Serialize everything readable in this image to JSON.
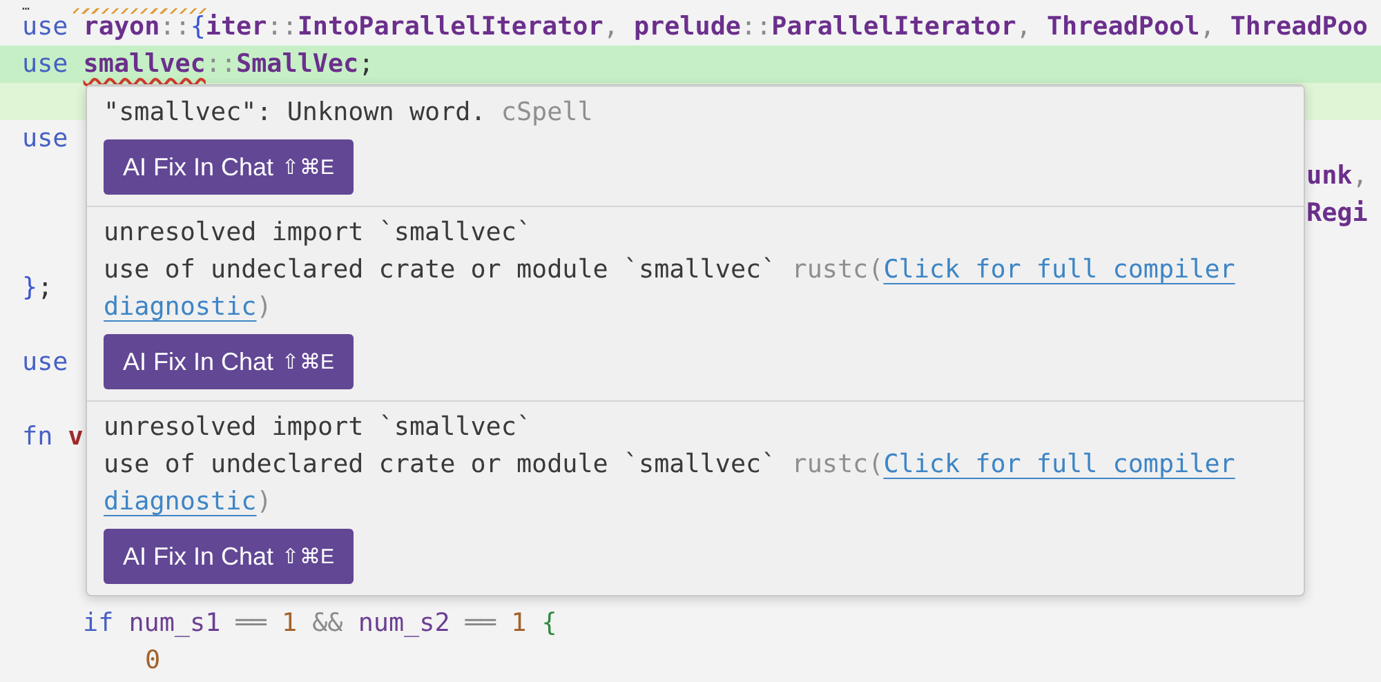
{
  "editor": {
    "lines": [
      {
        "kind": "partial",
        "warning": true,
        "tokens": [
          {
            "text": "…",
            "kind": "plain"
          }
        ]
      },
      {
        "kind": "code",
        "tokens": [
          {
            "text": "use ",
            "kind": "keyword"
          },
          {
            "text": "rayon",
            "kind": "type"
          },
          {
            "text": "::",
            "kind": "punct"
          },
          {
            "text": "{",
            "kind": "brace"
          },
          {
            "text": "iter",
            "kind": "type"
          },
          {
            "text": "::",
            "kind": "punct"
          },
          {
            "text": "IntoParallelIterator",
            "kind": "type"
          },
          {
            "text": ", ",
            "kind": "punct"
          },
          {
            "text": "prelude",
            "kind": "type"
          },
          {
            "text": "::",
            "kind": "punct"
          },
          {
            "text": "ParallelIterator",
            "kind": "type"
          },
          {
            "text": ", ",
            "kind": "punct"
          },
          {
            "text": "ThreadPool",
            "kind": "type"
          },
          {
            "text": ", ",
            "kind": "punct"
          },
          {
            "text": "ThreadPoo",
            "kind": "type"
          }
        ]
      },
      {
        "kind": "code",
        "highlighted": true,
        "tokens": [
          {
            "text": "use ",
            "kind": "keyword"
          },
          {
            "text": "smallvec",
            "kind": "type",
            "misspelled": true
          },
          {
            "text": "::",
            "kind": "punct"
          },
          {
            "text": "SmallVec",
            "kind": "type"
          },
          {
            "text": ";",
            "kind": "plain"
          }
        ]
      },
      {
        "kind": "blank",
        "secondary_highlight": true
      },
      {
        "kind": "code",
        "tokens": [
          {
            "text": "use",
            "kind": "keyword"
          }
        ]
      },
      {
        "kind": "tail",
        "tokens": [
          {
            "text": "unk",
            "kind": "type"
          },
          {
            "text": ",",
            "kind": "punct"
          }
        ]
      },
      {
        "kind": "tail",
        "tokens": [
          {
            "text": "Regi",
            "kind": "type"
          }
        ]
      },
      {
        "kind": "blank"
      },
      {
        "kind": "code",
        "tokens": [
          {
            "text": "}",
            "kind": "brace"
          },
          {
            "text": ";",
            "kind": "plain"
          }
        ]
      },
      {
        "kind": "blank"
      },
      {
        "kind": "code",
        "tokens": [
          {
            "text": "use",
            "kind": "keyword"
          }
        ]
      },
      {
        "kind": "blank"
      },
      {
        "kind": "code",
        "tokens": [
          {
            "text": "fn ",
            "kind": "keyword"
          },
          {
            "text": "v",
            "kind": "function"
          }
        ]
      },
      {
        "kind": "blank"
      },
      {
        "kind": "blank"
      },
      {
        "kind": "blank"
      },
      {
        "kind": "blank"
      },
      {
        "kind": "nested",
        "tokens": [
          {
            "text": "if ",
            "kind": "keyword"
          },
          {
            "text": "num_s1",
            "kind": "variable"
          },
          {
            "text": " ══ ",
            "kind": "punct"
          },
          {
            "text": "1",
            "kind": "number"
          },
          {
            "text": " && ",
            "kind": "punct"
          },
          {
            "text": "num_s2",
            "kind": "variable"
          },
          {
            "text": " ══ ",
            "kind": "punct"
          },
          {
            "text": "1 ",
            "kind": "number"
          },
          {
            "text": "{",
            "kind": "brace2"
          }
        ]
      },
      {
        "kind": "nested2",
        "tokens": [
          {
            "text": "0",
            "kind": "number"
          }
        ]
      }
    ]
  },
  "hover": {
    "sections": [
      {
        "lines": [
          [
            {
              "text": "\"smallvec\": Unknown word. ",
              "kind": "text"
            },
            {
              "text": "cSpell",
              "kind": "source"
            }
          ]
        ],
        "button": {
          "label": "AI Fix In Chat",
          "shortcut": "⇧⌘E"
        }
      },
      {
        "lines": [
          [
            {
              "text": "unresolved import `smallvec`",
              "kind": "text"
            }
          ],
          [
            {
              "text": "use of undeclared crate or module `smallvec` ",
              "kind": "text"
            },
            {
              "text": "rustc(",
              "kind": "source"
            },
            {
              "text": "Click for full compiler",
              "kind": "link"
            }
          ],
          [
            {
              "text": "diagnostic",
              "kind": "link"
            },
            {
              "text": ")",
              "kind": "source"
            }
          ]
        ],
        "button": {
          "label": "AI Fix In Chat",
          "shortcut": "⇧⌘E"
        }
      },
      {
        "lines": [
          [
            {
              "text": "unresolved import `smallvec`",
              "kind": "text"
            }
          ],
          [
            {
              "text": "use of undeclared crate or module `smallvec` ",
              "kind": "text"
            },
            {
              "text": "rustc(",
              "kind": "source"
            },
            {
              "text": "Click for full compiler",
              "kind": "link"
            }
          ],
          [
            {
              "text": "diagnostic",
              "kind": "link"
            },
            {
              "text": ")",
              "kind": "source"
            }
          ]
        ],
        "button": {
          "label": "AI Fix In Chat",
          "shortcut": "⇧⌘E"
        }
      }
    ]
  }
}
